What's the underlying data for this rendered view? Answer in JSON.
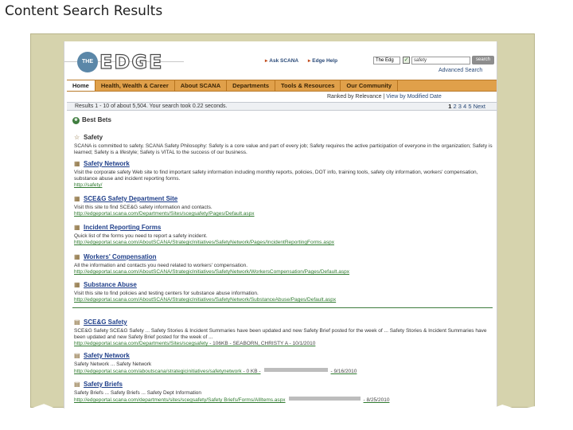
{
  "slide_title": "Content Search Results",
  "header": {
    "logo_badge": "THE",
    "logo_word": "EDGE",
    "links": [
      {
        "label": "Ask SCANA"
      },
      {
        "label": "Edge Help"
      }
    ],
    "scope_value": "The Edg",
    "search_value": "safety",
    "search_button": "search",
    "advanced_search": "Advanced Search"
  },
  "nav": {
    "items": [
      "Home",
      "Health, Wealth & Career",
      "About SCANA",
      "Departments",
      "Tools & Resources",
      "Our Community"
    ]
  },
  "sort": {
    "prefix": "Ranked by Relevance",
    "separator": "|",
    "link": "View by Modified Date"
  },
  "results_bar": {
    "count_text": "Results 1 - 10 of about 5,504. Your search took 0.22 seconds.",
    "pages": [
      "1",
      "2",
      "3",
      "4",
      "5"
    ],
    "next": "Next"
  },
  "best_bets": {
    "heading": "Best Bets",
    "items": [
      {
        "title": "Safety",
        "desc": "SCANA is committed to safety. SCANA Safety Philosophy: Safety is a core value and part of every job; Safety requires the active participation of everyone in the organization; Safety is learned; Safety is a lifestyle; Safety is VITAL to the success of our business.",
        "url": ""
      },
      {
        "title": "Safety Network",
        "desc": "Visit the corporate safety Web site to find important safety information including monthly reports, policies, DOT info, training tools, safety city information, workers' compensation, substance abuse and incident reporting forms.",
        "url": "http://safety/"
      },
      {
        "title": "SCE&G Safety Department Site",
        "desc": "Visit this site to find SCE&G safety information and contacts.",
        "url": "http://edgeportal.scana.com/Departments/Sites/scegsafety/Pages/Default.aspx"
      },
      {
        "title": "Incident Reporting Forms",
        "desc": "Quick list of the forms you need to report a safety incident.",
        "url": "http://edgeportal.scana.com/AboutSCANA/StrategicInitiatives/SafetyNetwork/Pages/IncidentReportingForms.aspx"
      },
      {
        "title": "Workers' Compensation",
        "desc": "All the information and contacts you need related to workers' compensation.",
        "url": "http://edgeportal.scana.com/AboutSCANA/StrategicInitiatives/SafetyNetwork/WorkersCompensation/Pages/Default.aspx"
      },
      {
        "title": "Substance Abuse",
        "desc": "Visit this site to find policies and testing centers for substance abuse information.",
        "url": "http://edgeportal.scana.com/AboutSCANA/StrategicInitiatives/SafetyNetwork/SubstanceAbuse/Pages/Default.aspx"
      }
    ]
  },
  "results": [
    {
      "title": "SCE&G Safety",
      "desc": "SCE&G Safety SCE&G Safety ... Safety Stories & Incident Summaries have been updated and new Safety Brief posted for the week of ... Safety Stories & Incident Summaries have been updated and new Safety Brief posted for the week of ...",
      "url": "http://edgeportal.scana.com/Departments/Sites/scegsafety",
      "meta": "- 106KB - SEABORN, CHRISTY A - 10/1/2010"
    },
    {
      "title": "Safety Network",
      "desc": "Safety Network ... Safety Network",
      "url": "http://edgeportal.scana.com/aboutscana/strategicinitiatives/safetynetwork",
      "meta": "- 0 KB -",
      "date": "- 9/16/2010"
    },
    {
      "title": "Safety Briefs",
      "desc": "Safety Briefs ... Safety Briefs ... Safety Dept Information",
      "url": "http://edgeportal.scana.com/departments/sites/scegsafety/Safety Briefs/Forms/AllItems.aspx",
      "date": "- 8/25/2010"
    }
  ]
}
